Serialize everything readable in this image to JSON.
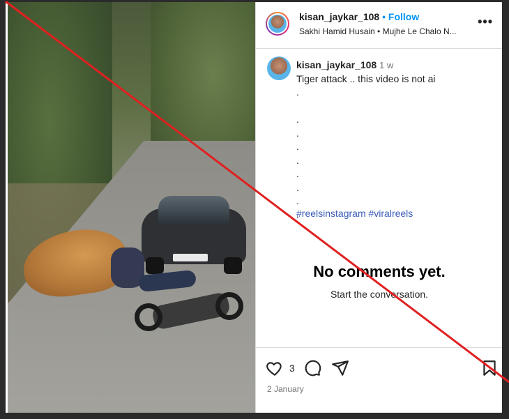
{
  "post": {
    "username": "kisan_jaykar_108",
    "follow_dot": "•",
    "follow_label": "Follow",
    "audio": "Sakhi Hamid Husain • Mujhe Le Chalo N...",
    "more_label": "•••"
  },
  "caption": {
    "username": "kisan_jaykar_108",
    "time": "1 w",
    "text": "Tiger attack .. this video is not ai",
    "dots": ".\n\n.\n.\n.\n.\n.\n.\n.\n.",
    "tags": "#reelsinstagram #viralreels"
  },
  "comments": {
    "empty_title": "No comments yet.",
    "empty_subtitle": "Start the conversation."
  },
  "footer": {
    "like_count": "3",
    "date": "2 January"
  },
  "icons": {
    "like": "heart-icon",
    "comment": "comment-icon",
    "share": "share-icon",
    "save": "bookmark-icon",
    "more": "more-icon"
  },
  "colors": {
    "accent": "#0095f6",
    "hashtag": "#3b5cb8",
    "slash": "#e02020"
  }
}
